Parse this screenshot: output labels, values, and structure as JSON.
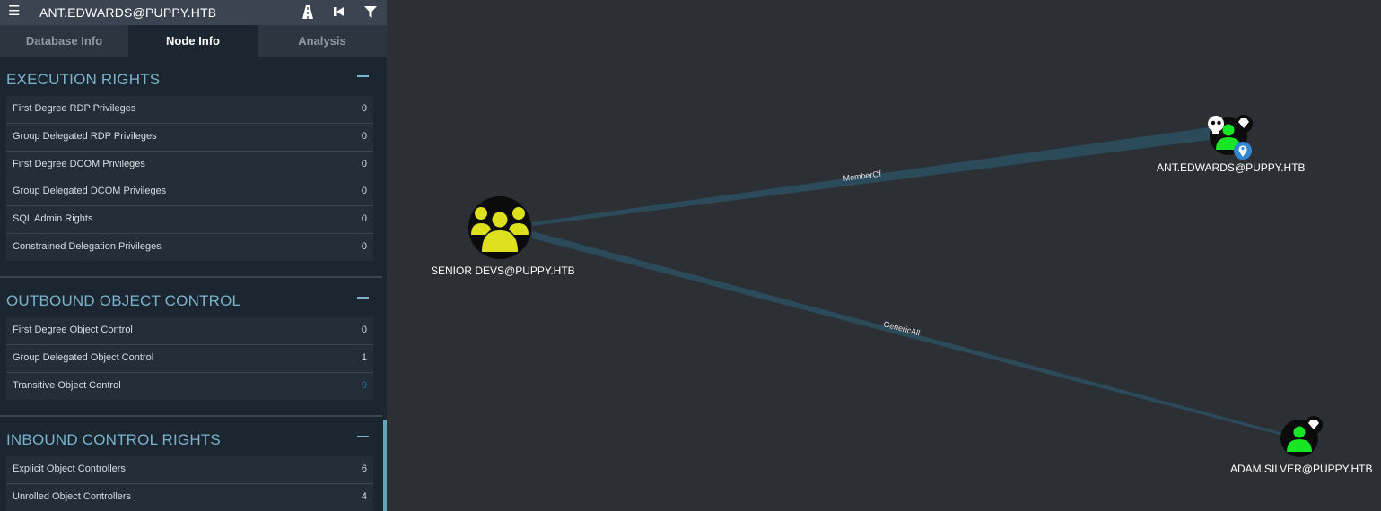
{
  "header": {
    "title": "ANT.EDWARDS@PUPPY.HTB",
    "icons": [
      "menu-icon",
      "pathfinding-icon",
      "back-icon",
      "filter-icon"
    ]
  },
  "tabs": [
    {
      "label": "Database Info",
      "active": false
    },
    {
      "label": "Node Info",
      "active": true
    },
    {
      "label": "Analysis",
      "active": false
    }
  ],
  "sections": [
    {
      "title": "EXECUTION RIGHTS",
      "rows": [
        {
          "label": "First Degree RDP Privileges",
          "count": "0"
        },
        {
          "label": "Group Delegated RDP Privileges",
          "count": "0"
        },
        {
          "label": "First Degree DCOM Privileges",
          "count": "0"
        },
        {
          "label": "Group Delegated DCOM Privileges",
          "count": "0"
        },
        {
          "label": "SQL Admin Rights",
          "count": "0"
        },
        {
          "label": "Constrained Delegation Privileges",
          "count": "0"
        }
      ]
    },
    {
      "title": "OUTBOUND OBJECT CONTROL",
      "rows": [
        {
          "label": "First Degree Object Control",
          "count": "0"
        },
        {
          "label": "Group Delegated Object Control",
          "count": "1"
        },
        {
          "label": "Transitive Object Control",
          "count": "9"
        }
      ]
    },
    {
      "title": "INBOUND CONTROL RIGHTS",
      "rows": [
        {
          "label": "Explicit Object Controllers",
          "count": "6"
        },
        {
          "label": "Unrolled Object Controllers",
          "count": "4"
        }
      ]
    }
  ],
  "graph": {
    "nodes": [
      {
        "label": "SENIOR DEVS@PUPPY.HTB",
        "type": "group",
        "color": "#dde01c"
      },
      {
        "label": "ANT.EDWARDS@PUPPY.HTB",
        "type": "user",
        "color": "#17e625",
        "markers": [
          "skull-icon",
          "diamond-icon",
          "location-pin-icon"
        ]
      },
      {
        "label": "ADAM.SILVER@PUPPY.HTB",
        "type": "user",
        "color": "#17e625",
        "markers": [
          "diamond-icon"
        ]
      }
    ],
    "edges": [
      {
        "label": "MemberOf"
      },
      {
        "label": "GenericAll"
      }
    ]
  },
  "colors": {
    "background": "#2c3035",
    "panel": "#1b2631",
    "accent": "#7ab3cc",
    "edge": "#2b4b5b",
    "group_node": "#dde01c",
    "user_node": "#17e625"
  }
}
